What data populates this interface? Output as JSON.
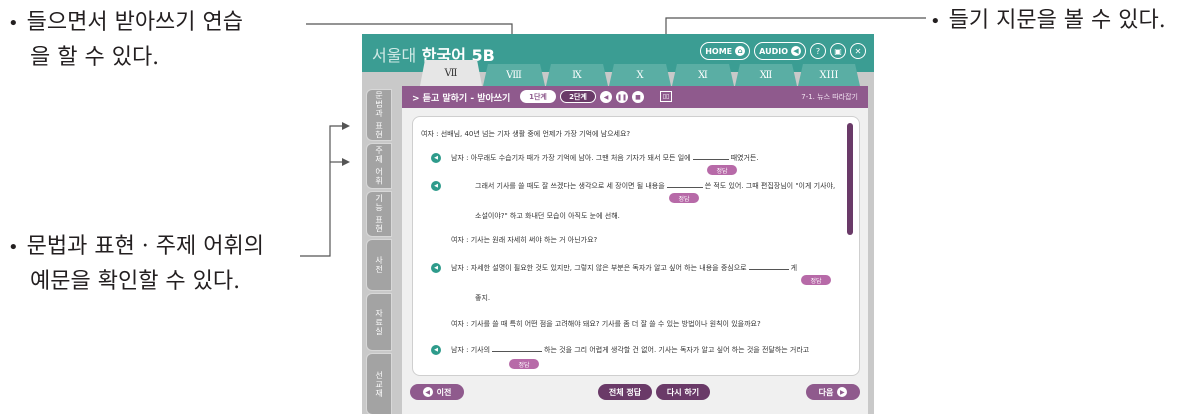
{
  "callouts": {
    "left_top_1": "들으면서 받아쓰기 연습",
    "left_top_2": "을 할 수 있다.",
    "left_mid_1": "문법과 표현 · 주제 어휘의",
    "left_mid_2": "예문을 확인할 수 있다.",
    "right_top": "들기 지문을 볼 수 있다.",
    "bullet": "•"
  },
  "app": {
    "title_a": "서울대",
    "title_b": "한국어 5B",
    "home_label": "HOME",
    "audio_label": "AUDIO",
    "chapter_tabs": [
      "Ⅶ",
      "Ⅷ",
      "Ⅸ",
      "Ⅹ",
      "Ⅺ",
      "Ⅻ",
      "XIII"
    ],
    "side_tabs": [
      "문법과 표현",
      "주제 어휘",
      "기능 표현",
      "사전",
      "자료실",
      "선교재"
    ],
    "subbar": {
      "title": "> 듣고 말하기 - 받아쓰기",
      "step1": "1단계",
      "step2": "2단계",
      "lesson": "7-1. 뉴스 따라잡기"
    },
    "answer_label": "정답",
    "lines": [
      {
        "speaker": "여자 :",
        "text": "선배님, 40년 넘는 기자 생활 중에 언제가 가장 기억에 남으세요?"
      },
      {
        "speaker": "남자 :",
        "before": "아무래도 수습기자 때가 가장 기억에 남아. 그땐 처음 기자가 돼서 모든 일에",
        "after": "때였거든."
      },
      {
        "speaker": "",
        "before": "그래서 기사를 쓸 때도 잘 쓰겠다는 생각으로 세 장이면 될 내용을",
        "after": "쓴 적도 있어. 그때 편집장님이 \"이게 기사야,"
      },
      {
        "speaker": "",
        "text": "소설이야?\" 하고 화내던 모습이 아직도 눈에 선해."
      },
      {
        "speaker": "여자 :",
        "text": "기사는 원래 자세히 써야 하는 거 아닌가요?"
      },
      {
        "speaker": "남자 :",
        "before": "자세한 설명이 필요한 것도 있지만, 그렇지 않은 부분은 독자가 알고 싶어 하는 내용을 중심으로",
        "after": "게"
      },
      {
        "speaker": "",
        "text": "좋지."
      },
      {
        "speaker": "여자 :",
        "text": "기사를 쓸 때 특히 어떤 점을 고려해야 돼요? 기사를 좀 더 잘 쓸 수 있는 방법이나 원칙이 있을까요?"
      },
      {
        "speaker": "남자 :",
        "before": "기사의",
        "after": "하는 것을 그리 어렵게 생각할 건 없어. 기사는 독자가 알고 싶어 하는 것을 전달하는 거라고"
      }
    ],
    "buttons": {
      "prev": "이전",
      "all_answers": "전체 정답",
      "retry": "다시 하기",
      "next": "다음"
    }
  }
}
